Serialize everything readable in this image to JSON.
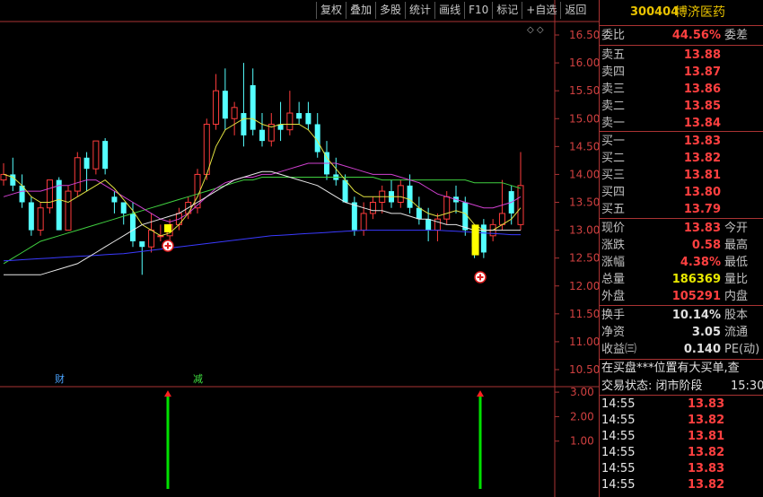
{
  "toolbar": {
    "items": [
      "复权",
      "叠加",
      "多股",
      "统计",
      "画线",
      "F10",
      "标记",
      "+自选",
      "返回"
    ]
  },
  "chart": {
    "price_ticks": [
      "16.50",
      "16.00",
      "15.50",
      "15.00",
      "14.50",
      "14.00",
      "13.50",
      "13.00",
      "12.50",
      "12.00",
      "11.50",
      "11.00",
      "10.50"
    ],
    "indicator_ticks": [
      "3.00",
      "2.00",
      "1.00"
    ],
    "badge_cai": "财",
    "badge_jian": "减",
    "diamond_icons": "◇ ◇"
  },
  "quote": {
    "code": "300404",
    "name": "博济医药",
    "weibi_label": "委比",
    "weibi_value": "44.56%",
    "weicha_label": "委差",
    "asks": [
      {
        "label": "卖五",
        "price": "13.88"
      },
      {
        "label": "卖四",
        "price": "13.87"
      },
      {
        "label": "卖三",
        "price": "13.86"
      },
      {
        "label": "卖二",
        "price": "13.85"
      },
      {
        "label": "卖一",
        "price": "13.84"
      }
    ],
    "bids": [
      {
        "label": "买一",
        "price": "13.83"
      },
      {
        "label": "买二",
        "price": "13.82"
      },
      {
        "label": "买三",
        "price": "13.81"
      },
      {
        "label": "买四",
        "price": "13.80"
      },
      {
        "label": "买五",
        "price": "13.79"
      }
    ],
    "stats1": [
      {
        "label": "现价",
        "value": "13.83",
        "label2": "今开"
      },
      {
        "label": "涨跌",
        "value": "0.58",
        "label2": "最高"
      },
      {
        "label": "涨幅",
        "value": "4.38%",
        "label2": "最低"
      },
      {
        "label": "总量",
        "value": "186369",
        "label2": "量比"
      },
      {
        "label": "外盘",
        "value": "105291",
        "label2": "内盘"
      }
    ],
    "stats2": [
      {
        "label": "换手",
        "value": "10.14%",
        "label2": "股本"
      },
      {
        "label": "净资",
        "value": "3.05",
        "label2": "流通"
      },
      {
        "label": "收益㈢",
        "value": "0.140",
        "label2": "PE(动)"
      }
    ],
    "message": "在买盘***位置有大买单,查",
    "status_label": "交易状态: 闭市阶段",
    "status_time": "15:30:",
    "ticks": [
      {
        "time": "14:55",
        "price": "13.83"
      },
      {
        "time": "14:55",
        "price": "13.82"
      },
      {
        "time": "14:55",
        "price": "13.81"
      },
      {
        "time": "14:55",
        "price": "13.82"
      },
      {
        "time": "14:55",
        "price": "13.83"
      },
      {
        "time": "14:55",
        "price": "13.82"
      }
    ]
  },
  "chart_data": {
    "type": "candlestick",
    "ylim": [
      10.3,
      16.7
    ],
    "candles": [
      {
        "o": 13.9,
        "h": 14.2,
        "l": 13.8,
        "c": 14.0
      },
      {
        "o": 14.0,
        "h": 14.3,
        "l": 13.7,
        "c": 13.8
      },
      {
        "o": 13.8,
        "h": 14.0,
        "l": 13.4,
        "c": 13.5
      },
      {
        "o": 13.5,
        "h": 13.6,
        "l": 12.9,
        "c": 13.0
      },
      {
        "o": 13.0,
        "h": 13.5,
        "l": 12.9,
        "c": 13.4
      },
      {
        "o": 13.4,
        "h": 13.9,
        "l": 13.3,
        "c": 13.9
      },
      {
        "o": 13.9,
        "h": 13.95,
        "l": 13.0,
        "c": 13.0
      },
      {
        "o": 13.0,
        "h": 13.8,
        "l": 13.0,
        "c": 13.7
      },
      {
        "o": 13.7,
        "h": 14.4,
        "l": 13.6,
        "c": 14.3
      },
      {
        "o": 14.3,
        "h": 14.4,
        "l": 13.7,
        "c": 14.1
      },
      {
        "o": 14.1,
        "h": 14.6,
        "l": 14.0,
        "c": 14.6
      },
      {
        "o": 14.6,
        "h": 14.65,
        "l": 14.0,
        "c": 14.1
      },
      {
        "o": 13.6,
        "h": 13.7,
        "l": 13.3,
        "c": 13.5
      },
      {
        "o": 13.5,
        "h": 13.5,
        "l": 13.1,
        "c": 13.3
      },
      {
        "o": 13.3,
        "h": 13.5,
        "l": 12.7,
        "c": 12.8
      },
      {
        "o": 12.8,
        "h": 12.8,
        "l": 12.2,
        "c": 12.7
      },
      {
        "o": 12.7,
        "h": 13.3,
        "l": 12.6,
        "c": 13.0
      },
      {
        "o": 12.9,
        "h": 13.1,
        "l": 12.8,
        "c": 12.9
      },
      {
        "o": 12.9,
        "h": 13.2,
        "l": 12.8,
        "c": 13.1
      },
      {
        "o": 13.1,
        "h": 13.4,
        "l": 13.0,
        "c": 13.3
      },
      {
        "o": 13.3,
        "h": 13.6,
        "l": 13.2,
        "c": 13.5
      },
      {
        "o": 13.4,
        "h": 14.1,
        "l": 13.3,
        "c": 14.0
      },
      {
        "o": 14.0,
        "h": 15.0,
        "l": 13.9,
        "c": 14.9
      },
      {
        "o": 14.9,
        "h": 15.8,
        "l": 14.8,
        "c": 15.5
      },
      {
        "o": 15.5,
        "h": 15.9,
        "l": 14.8,
        "c": 15.0
      },
      {
        "o": 15.0,
        "h": 15.3,
        "l": 14.7,
        "c": 15.2
      },
      {
        "o": 15.1,
        "h": 16.0,
        "l": 14.5,
        "c": 14.7
      },
      {
        "o": 15.6,
        "h": 15.9,
        "l": 14.7,
        "c": 14.8
      },
      {
        "o": 14.8,
        "h": 15.1,
        "l": 14.5,
        "c": 14.6
      },
      {
        "o": 14.6,
        "h": 15.1,
        "l": 14.5,
        "c": 14.9
      },
      {
        "o": 14.9,
        "h": 15.3,
        "l": 14.6,
        "c": 14.8
      },
      {
        "o": 14.8,
        "h": 15.5,
        "l": 14.7,
        "c": 15.1
      },
      {
        "o": 15.1,
        "h": 15.3,
        "l": 14.9,
        "c": 15.0
      },
      {
        "o": 15.1,
        "h": 15.3,
        "l": 14.8,
        "c": 14.9
      },
      {
        "o": 14.9,
        "h": 15.1,
        "l": 14.3,
        "c": 14.4
      },
      {
        "o": 14.4,
        "h": 14.6,
        "l": 13.9,
        "c": 14.0
      },
      {
        "o": 14.0,
        "h": 14.3,
        "l": 13.8,
        "c": 13.9
      },
      {
        "o": 13.9,
        "h": 14.0,
        "l": 13.5,
        "c": 13.5
      },
      {
        "o": 13.5,
        "h": 13.6,
        "l": 12.9,
        "c": 13.0
      },
      {
        "o": 13.0,
        "h": 13.5,
        "l": 12.9,
        "c": 13.3
      },
      {
        "o": 13.3,
        "h": 13.6,
        "l": 13.2,
        "c": 13.5
      },
      {
        "o": 13.5,
        "h": 13.8,
        "l": 13.3,
        "c": 13.7
      },
      {
        "o": 13.7,
        "h": 13.9,
        "l": 13.4,
        "c": 13.5
      },
      {
        "o": 13.5,
        "h": 13.9,
        "l": 13.4,
        "c": 13.8
      },
      {
        "o": 13.8,
        "h": 14.0,
        "l": 13.3,
        "c": 13.4
      },
      {
        "o": 13.4,
        "h": 13.6,
        "l": 13.1,
        "c": 13.2
      },
      {
        "o": 13.2,
        "h": 13.4,
        "l": 12.8,
        "c": 13.0
      },
      {
        "o": 13.0,
        "h": 13.3,
        "l": 12.8,
        "c": 13.2
      },
      {
        "o": 13.2,
        "h": 13.7,
        "l": 13.1,
        "c": 13.6
      },
      {
        "o": 13.6,
        "h": 13.8,
        "l": 13.3,
        "c": 13.5
      },
      {
        "o": 13.5,
        "h": 13.6,
        "l": 12.9,
        "c": 13.0
      },
      {
        "o": 13.0,
        "h": 13.1,
        "l": 12.5,
        "c": 12.7
      },
      {
        "o": 13.1,
        "h": 13.2,
        "l": 12.5,
        "c": 12.6
      },
      {
        "o": 12.9,
        "h": 13.2,
        "l": 12.8,
        "c": 13.1
      },
      {
        "o": 13.1,
        "h": 13.9,
        "l": 13.0,
        "c": 13.3
      },
      {
        "o": 13.7,
        "h": 13.8,
        "l": 13.1,
        "c": 13.3
      },
      {
        "o": 13.1,
        "h": 14.4,
        "l": 13.0,
        "c": 13.8
      }
    ],
    "ma_white": [
      12.2,
      12.2,
      12.2,
      12.2,
      12.2,
      12.25,
      12.3,
      12.35,
      12.4,
      12.5,
      12.6,
      12.7,
      12.8,
      12.9,
      13.0,
      13.1,
      13.15,
      13.2,
      13.25,
      13.3,
      13.4,
      13.5,
      13.6,
      13.7,
      13.8,
      13.9,
      13.95,
      14.0,
      14.05,
      14.05,
      14.0,
      13.95,
      13.9,
      13.85,
      13.8,
      13.7,
      13.6,
      13.5,
      13.45,
      13.4,
      13.35,
      13.35,
      13.3,
      13.3,
      13.25,
      13.2,
      13.2,
      13.15,
      13.1,
      13.1,
      13.05,
      13.0,
      13.0,
      13.0,
      13.0,
      13.0,
      13.0
    ],
    "ma_yellow": [
      14.0,
      13.95,
      13.8,
      13.6,
      13.5,
      13.5,
      13.55,
      13.5,
      13.6,
      13.7,
      13.8,
      13.9,
      13.75,
      13.55,
      13.35,
      13.1,
      13.0,
      12.9,
      12.95,
      13.1,
      13.3,
      13.6,
      14.0,
      14.5,
      14.8,
      14.9,
      15.0,
      15.0,
      14.9,
      14.85,
      14.9,
      14.9,
      14.9,
      14.8,
      14.6,
      14.3,
      14.1,
      13.9,
      13.7,
      13.6,
      13.6,
      13.6,
      13.6,
      13.6,
      13.55,
      13.4,
      13.3,
      13.25,
      13.3,
      13.35,
      13.3,
      13.1,
      13.0,
      13.0,
      13.1,
      13.2,
      13.4
    ],
    "ma_magenta": [
      13.6,
      13.65,
      13.7,
      13.7,
      13.7,
      13.75,
      13.8,
      13.8,
      13.85,
      13.9,
      13.9,
      13.8,
      13.7,
      13.6,
      13.5,
      13.4,
      13.3,
      13.2,
      13.15,
      13.2,
      13.3,
      13.45,
      13.6,
      13.75,
      13.85,
      13.9,
      13.95,
      13.95,
      14.0,
      14.0,
      14.05,
      14.1,
      14.15,
      14.2,
      14.2,
      14.2,
      14.2,
      14.15,
      14.1,
      14.05,
      14.0,
      14.0,
      14.0,
      13.95,
      13.9,
      13.85,
      13.75,
      13.65,
      13.6,
      13.55,
      13.5,
      13.45,
      13.4,
      13.4,
      13.45,
      13.5,
      13.6
    ],
    "ma_green": [
      12.4,
      12.5,
      12.6,
      12.7,
      12.8,
      12.85,
      12.9,
      12.95,
      13.0,
      13.05,
      13.1,
      13.15,
      13.2,
      13.25,
      13.3,
      13.35,
      13.4,
      13.45,
      13.5,
      13.55,
      13.6,
      13.65,
      13.7,
      13.75,
      13.8,
      13.85,
      13.9,
      13.9,
      13.95,
      13.95,
      13.95,
      13.95,
      13.95,
      13.95,
      13.95,
      13.95,
      13.95,
      13.95,
      13.95,
      13.95,
      13.95,
      13.9,
      13.9,
      13.9,
      13.9,
      13.9,
      13.9,
      13.9,
      13.9,
      13.9,
      13.9,
      13.85,
      13.85,
      13.85,
      13.85,
      13.8,
      13.75
    ],
    "ma_blue": [
      12.45,
      12.46,
      12.47,
      12.48,
      12.49,
      12.5,
      12.51,
      12.52,
      12.53,
      12.54,
      12.55,
      12.56,
      12.57,
      12.58,
      12.6,
      12.62,
      12.64,
      12.66,
      12.68,
      12.7,
      12.72,
      12.74,
      12.76,
      12.78,
      12.8,
      12.82,
      12.84,
      12.86,
      12.88,
      12.9,
      12.91,
      12.92,
      12.93,
      12.94,
      12.95,
      12.96,
      12.97,
      12.98,
      12.99,
      13.0,
      13.0,
      13.0,
      13.0,
      13.0,
      13.0,
      13.0,
      13.0,
      13.0,
      12.99,
      12.98,
      12.97,
      12.96,
      12.95,
      12.94,
      12.93,
      12.92,
      12.92
    ],
    "signals": [
      {
        "index": 17,
        "value": 3
      },
      {
        "index": 51,
        "value": 3
      }
    ],
    "indicator_ylim": [
      0,
      3.6
    ]
  }
}
